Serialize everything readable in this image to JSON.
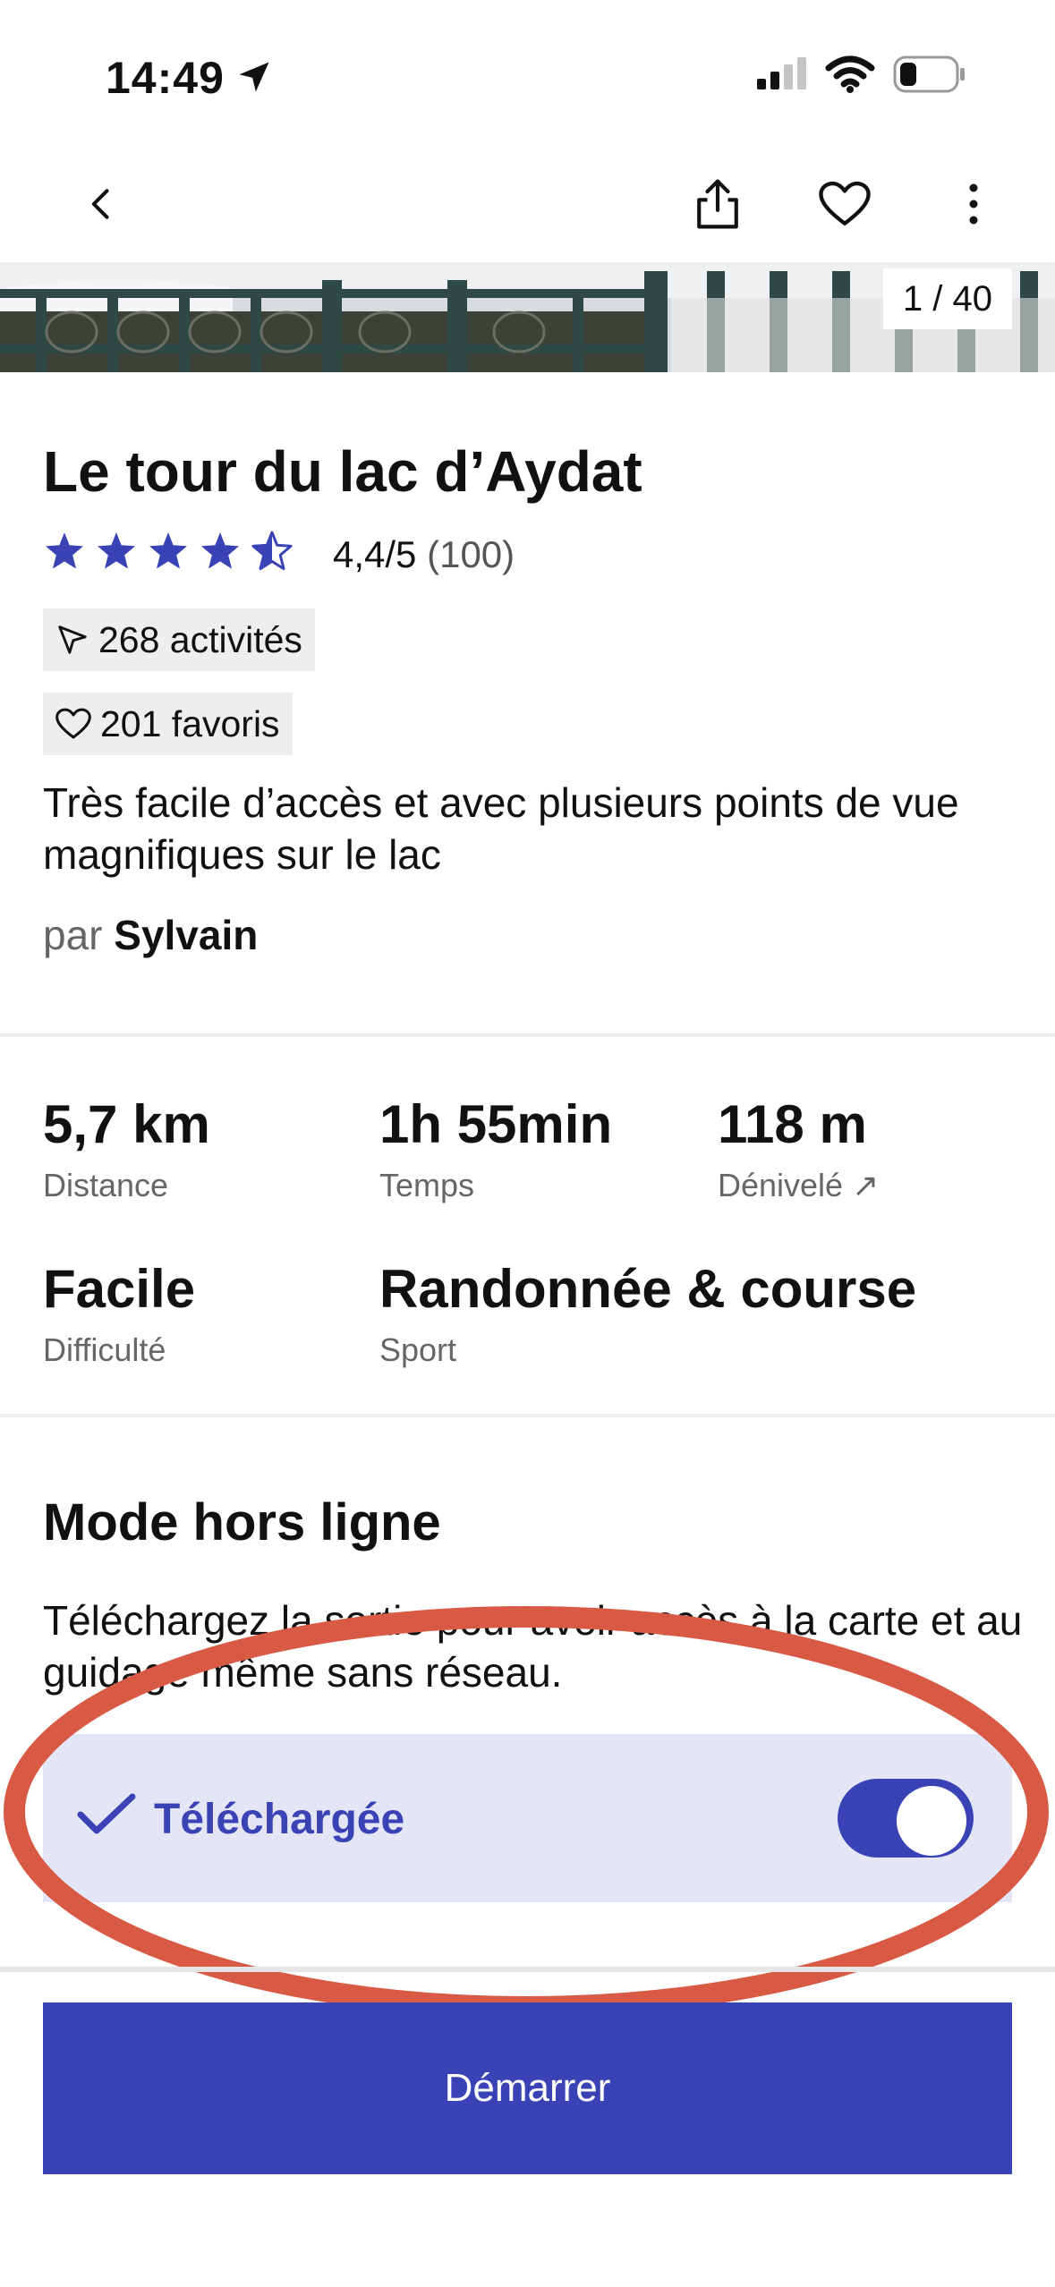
{
  "status_bar": {
    "time": "14:49"
  },
  "photo": {
    "counter": "1 / 40"
  },
  "route": {
    "title": "Le tour du lac d’Aydat",
    "rating": "4,4/5",
    "rating_count": "(100)",
    "rating_value": 4.4,
    "activities": "268 activités",
    "favorites": "201 favoris",
    "description": "Très facile d’accès et avec plusieurs points de vue magnifiques sur le lac",
    "author_prefix": "par",
    "author": "Sylvain"
  },
  "stats": {
    "distance_value": "5,7 km",
    "distance_label": "Distance",
    "time_value": "1h 55min",
    "time_label": "Temps",
    "elevation_value": "118 m",
    "elevation_label": "Dénivelé ↗",
    "difficulty_value": "Facile",
    "difficulty_label": "Difficulté",
    "sport_value": "Randonnée & course",
    "sport_label": "Sport"
  },
  "offline": {
    "title": "Mode hors ligne",
    "text": "Téléchargez la sortie pour avoir accès à la carte et au guidage même sans réseau.",
    "downloaded_label": "Téléchargée",
    "toggle_on": true
  },
  "actions": {
    "start_label": "Démarrer"
  },
  "colors": {
    "accent": "#3a43b5",
    "accent_light": "#e4e6f7",
    "annotation": "#d85a45"
  }
}
